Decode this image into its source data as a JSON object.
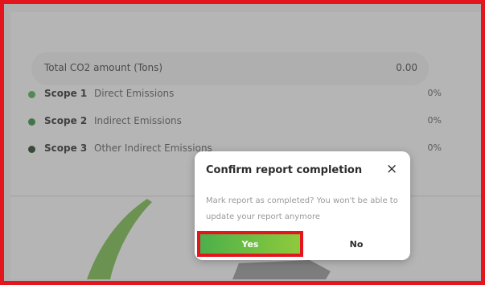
{
  "summary": {
    "total_label": "Total CO2 amount (Tons)",
    "total_value": "0.00"
  },
  "scopes": [
    {
      "name": "Scope 1",
      "description": "Direct Emissions",
      "percent": "0%",
      "color": "#4caf50"
    },
    {
      "name": "Scope 2",
      "description": "Indirect Emissions",
      "percent": "0%",
      "color": "#2e8b3a"
    },
    {
      "name": "Scope 3",
      "description": "Other Indirect Emissions",
      "percent": "0%",
      "color": "#1e3d1e"
    }
  ],
  "dialog": {
    "title": "Confirm report completion",
    "close_icon": "×",
    "message": "Mark report as completed? You won't be able to update your report anymore",
    "yes_label": "Yes",
    "no_label": "No"
  },
  "colors": {
    "highlight": "#e3151d",
    "accent_green": "#6dbb43"
  }
}
